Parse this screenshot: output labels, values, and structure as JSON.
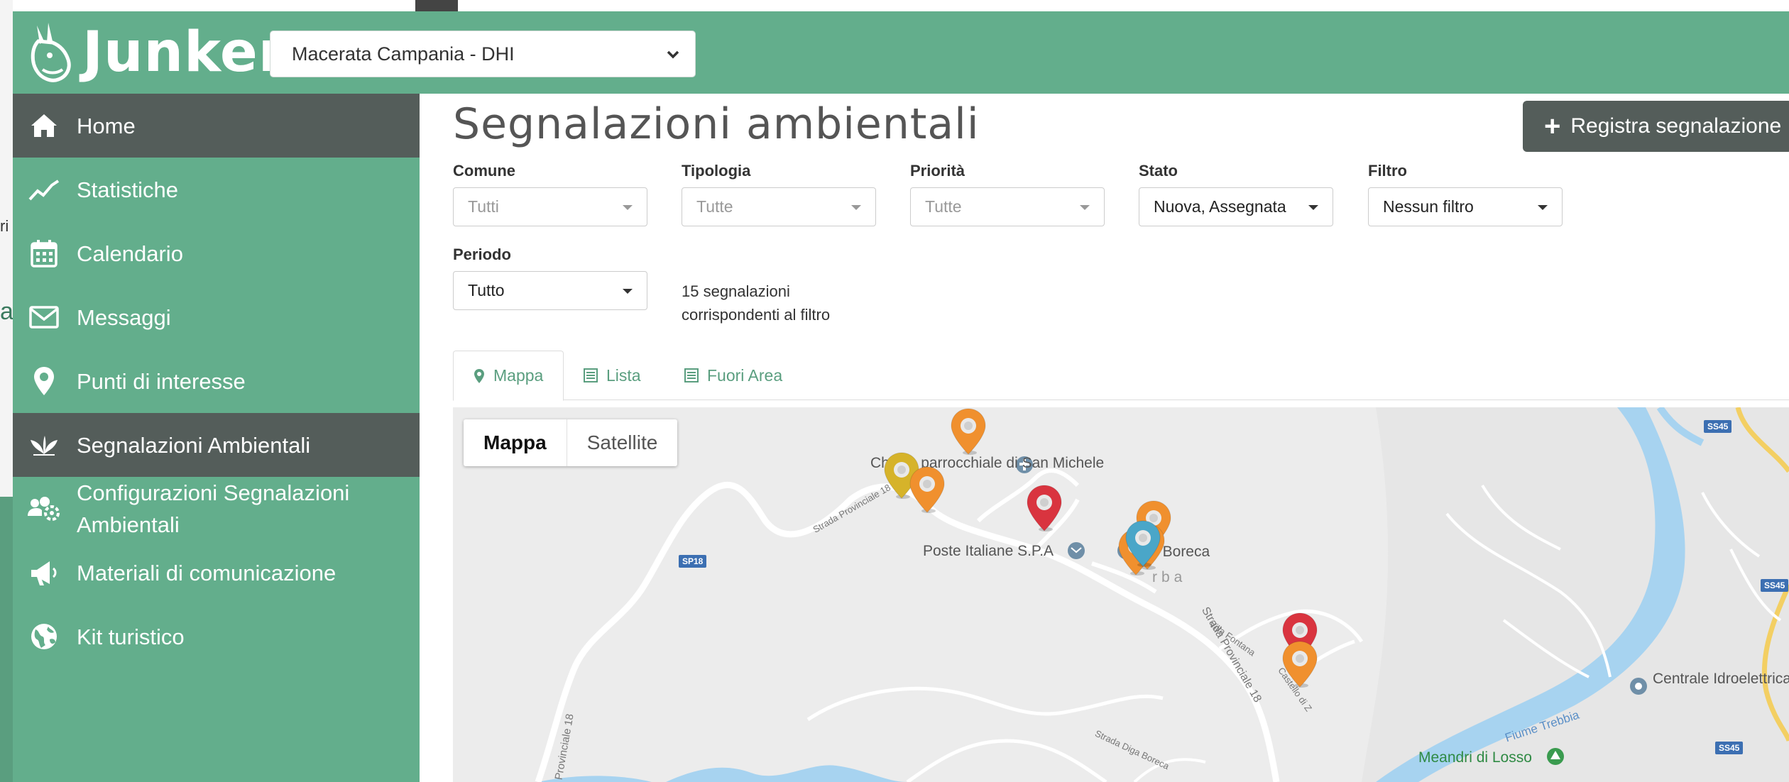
{
  "app": {
    "logo_text": "Junker",
    "site_select": "Macerata Campania - DHI"
  },
  "background": {
    "fragment_1": "ri",
    "fragment_2": "a"
  },
  "sidebar": {
    "items": [
      {
        "label": "Home",
        "icon": "home-icon"
      },
      {
        "label": "Statistiche",
        "icon": "chart-line-icon"
      },
      {
        "label": "Calendario",
        "icon": "calendar-icon"
      },
      {
        "label": "Messaggi",
        "icon": "envelope-icon"
      },
      {
        "label": "Punti di interesse",
        "icon": "map-pin-icon"
      },
      {
        "label": "Segnalazioni Ambientali",
        "icon": "leaf-icon"
      },
      {
        "label": "Configurazioni Segnalazioni Ambientali",
        "icon": "users-gear-icon"
      },
      {
        "label": "Materiali di comunicazione",
        "icon": "megaphone-icon"
      },
      {
        "label": "Kit turistico",
        "icon": "globe-icon"
      }
    ],
    "active_index": 5
  },
  "main": {
    "title": "Segnalazioni ambientali",
    "register_button": "Registra segnalazione",
    "filters": {
      "comune": {
        "label": "Comune",
        "value": "Tutti"
      },
      "tipologia": {
        "label": "Tipologia",
        "value": "Tutte"
      },
      "priorita": {
        "label": "Priorità",
        "value": "Tutte"
      },
      "stato": {
        "label": "Stato",
        "value": "Nuova, Assegnata"
      },
      "filtro": {
        "label": "Filtro",
        "value": "Nessun filtro"
      },
      "periodo": {
        "label": "Periodo",
        "value": "Tutto"
      }
    },
    "result_count": "15 segnalazioni corrispondenti al filtro",
    "tabs": [
      {
        "label": "Mappa",
        "icon": "map-marker-icon"
      },
      {
        "label": "Lista",
        "icon": "list-icon"
      },
      {
        "label": "Fuori Area",
        "icon": "list-icon"
      }
    ],
    "active_tab": 0
  },
  "map": {
    "type_options": [
      "Mappa",
      "Satellite"
    ],
    "selected_type": "Mappa",
    "places": {
      "church": "Chiesa parrocchiale di San Michele",
      "post": "Poste Italiane S.P.A",
      "val_boreca": "Val Boreca",
      "zerba": "rba",
      "centrale": "Centrale Idroelettrica Boreca",
      "fiume": "Fiume Trebbia",
      "meandri": "Meandri di Losso"
    },
    "roads": {
      "sp18_a": "Strada Provinciale 18",
      "sp18_b": "Strada Provinciale 18",
      "sp18_c": "Provinciale 18",
      "villa": "Villa Fontana",
      "castello": "Castello di Z",
      "diga": "Strada Diga Boreca"
    },
    "shields": {
      "sp18": "SP18",
      "ss45_a": "SS45",
      "ss45_b": "SS45",
      "ss45_c": "SS45"
    },
    "marker_colors": {
      "red": "#d9343f",
      "orange": "#f0902e",
      "yellow": "#d6b32a",
      "blue": "#4aa6c8"
    }
  }
}
